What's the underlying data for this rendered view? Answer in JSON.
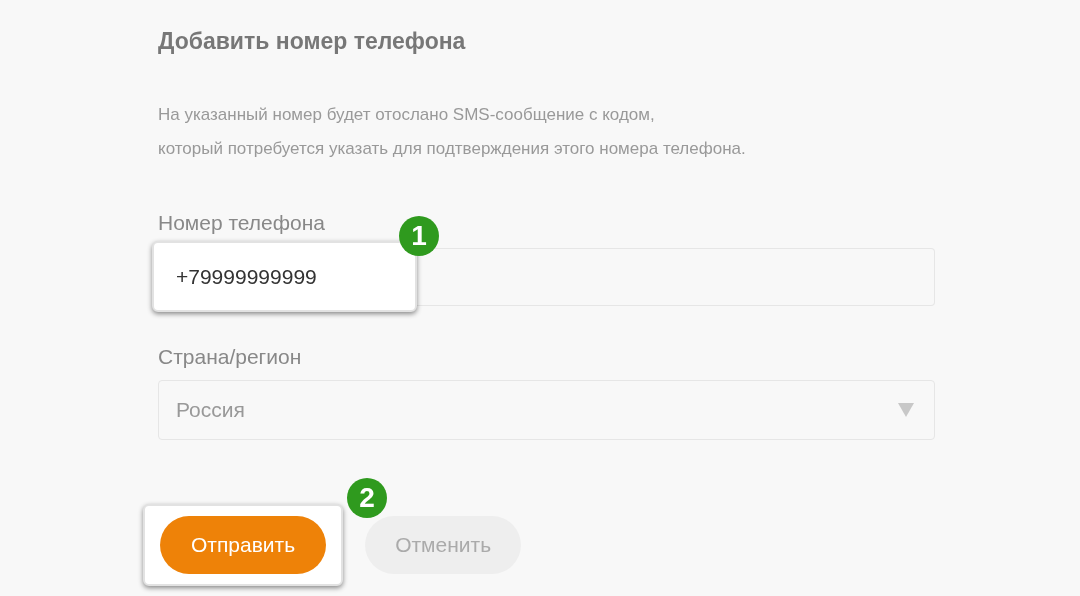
{
  "title": "Добавить номер телефона",
  "description": [
    "На указанный номер будет отослано SMS-сообщение с кодом,",
    "который потребуется указать для подтверждения этого номера телефона."
  ],
  "phone": {
    "label": "Номер телефона",
    "value": "+79999999999",
    "badge": "1"
  },
  "country": {
    "label": "Страна/регион",
    "value": "Россия"
  },
  "buttons": [
    {
      "label": "Отправить",
      "kind": "primary",
      "badge": "2"
    },
    {
      "label": "Отменить",
      "kind": "secondary"
    }
  ]
}
